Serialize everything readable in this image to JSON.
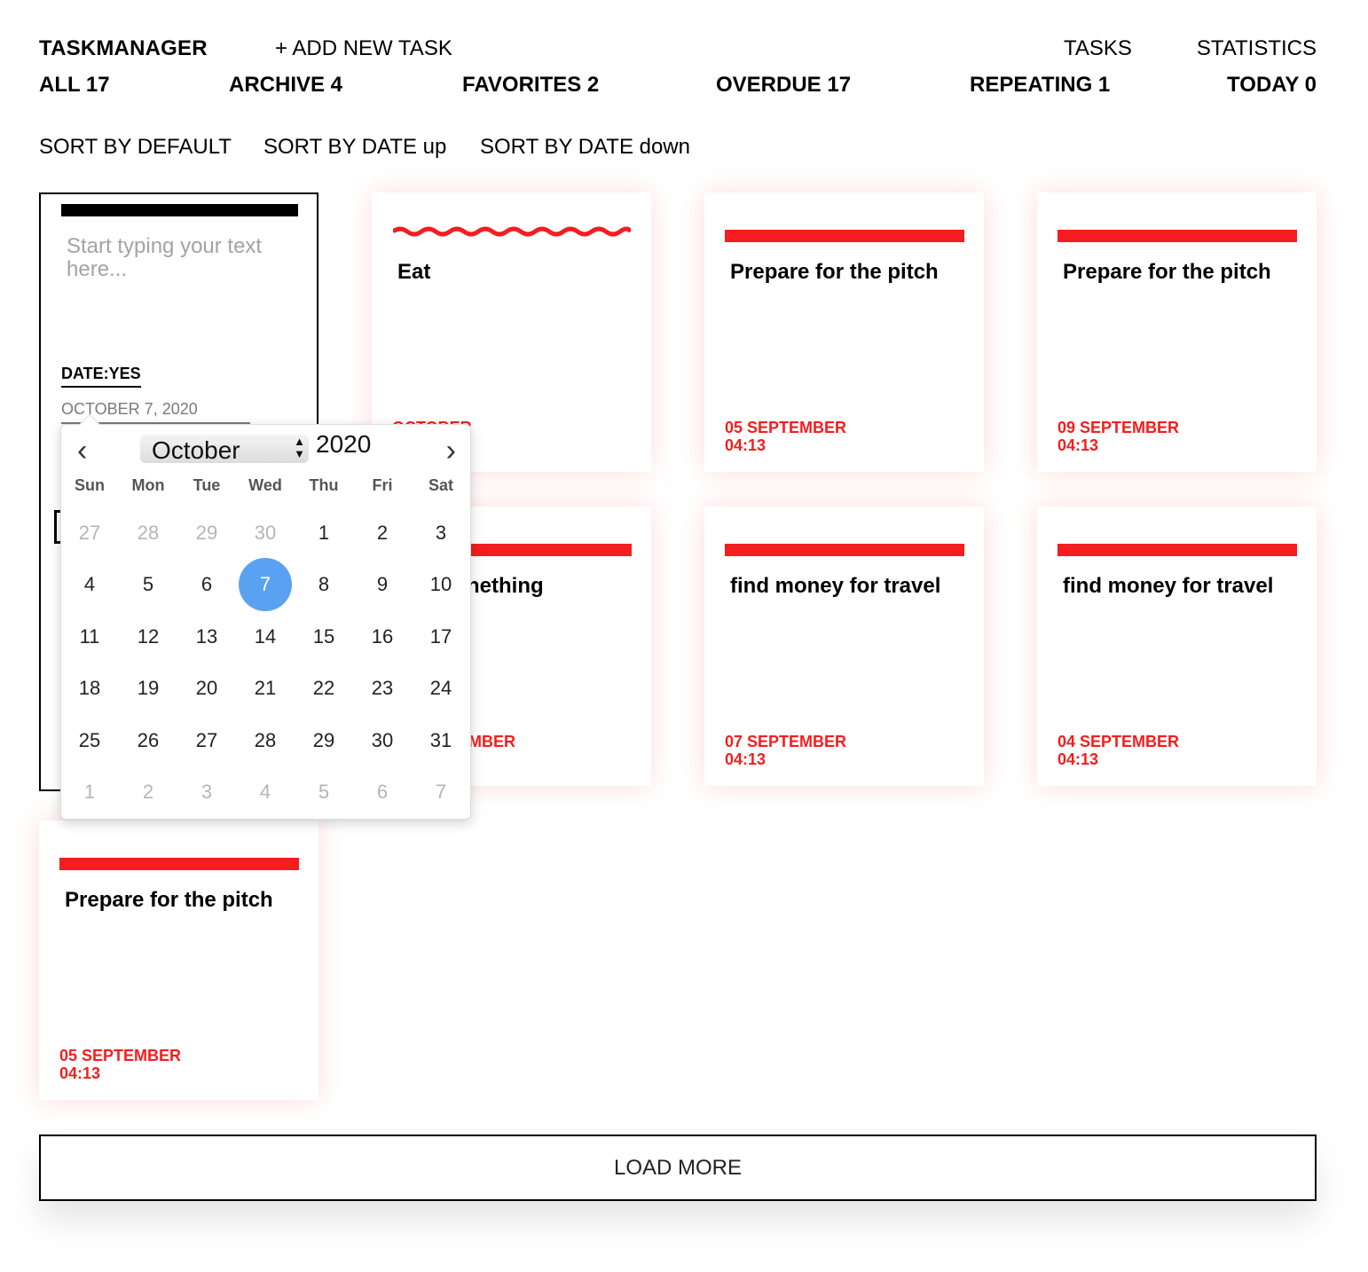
{
  "header": {
    "logo": "TASKMANAGER",
    "add_task": "+ ADD NEW TASK",
    "nav": {
      "tasks": "TASKS",
      "statistics": "STATISTICS"
    }
  },
  "filters": [
    {
      "label": "ALL 17"
    },
    {
      "label": "ARCHIVE 4"
    },
    {
      "label": "FAVORITES 2"
    },
    {
      "label": "OVERDUE 17"
    },
    {
      "label": "REPEATING 1"
    },
    {
      "label": "TODAY 0"
    }
  ],
  "sorts": [
    {
      "label": "SORT BY DEFAULT"
    },
    {
      "label": "SORT BY DATE up"
    },
    {
      "label": "SORT BY DATE down"
    }
  ],
  "edit_card": {
    "placeholder": "Start typing your text here...",
    "date_toggle": "DATE:YES",
    "date_value": "OCTOBER 7, 2020"
  },
  "datepicker": {
    "month": "October",
    "year": "2020",
    "weekdays": [
      "Sun",
      "Mon",
      "Tue",
      "Wed",
      "Thu",
      "Fri",
      "Sat"
    ],
    "weeks": [
      [
        "27",
        "28",
        "29",
        "30",
        "1",
        "2",
        "3"
      ],
      [
        "4",
        "5",
        "6",
        "7",
        "8",
        "9",
        "10"
      ],
      [
        "11",
        "12",
        "13",
        "14",
        "15",
        "16",
        "17"
      ],
      [
        "18",
        "19",
        "20",
        "21",
        "22",
        "23",
        "24"
      ],
      [
        "25",
        "26",
        "27",
        "28",
        "29",
        "30",
        "31"
      ],
      [
        "1",
        "2",
        "3",
        "4",
        "5",
        "6",
        "7"
      ]
    ],
    "selected": "7"
  },
  "cards": [
    {
      "title": "Eat",
      "date": "OCTOBER",
      "time": "",
      "repeating": true
    },
    {
      "title": "Prepare for the pitch",
      "date": "05 SEPTEMBER",
      "time": "04:13"
    },
    {
      "title": "Prepare for the pitch",
      "date": "09 SEPTEMBER",
      "time": "04:13"
    },
    {
      "title": "nething",
      "date": "MBER",
      "time": ""
    },
    {
      "title": "find money for travel",
      "date": "07 SEPTEMBER",
      "time": "04:13"
    },
    {
      "title": "find money for travel",
      "date": "04 SEPTEMBER",
      "time": "04:13"
    },
    {
      "title": "Prepare for the pitch",
      "date": "05 SEPTEMBER",
      "time": "04:13"
    }
  ],
  "load_more": "LOAD MORE",
  "colors": {
    "accent": "#f51d1d",
    "selected_day": "#5aa1f2"
  }
}
